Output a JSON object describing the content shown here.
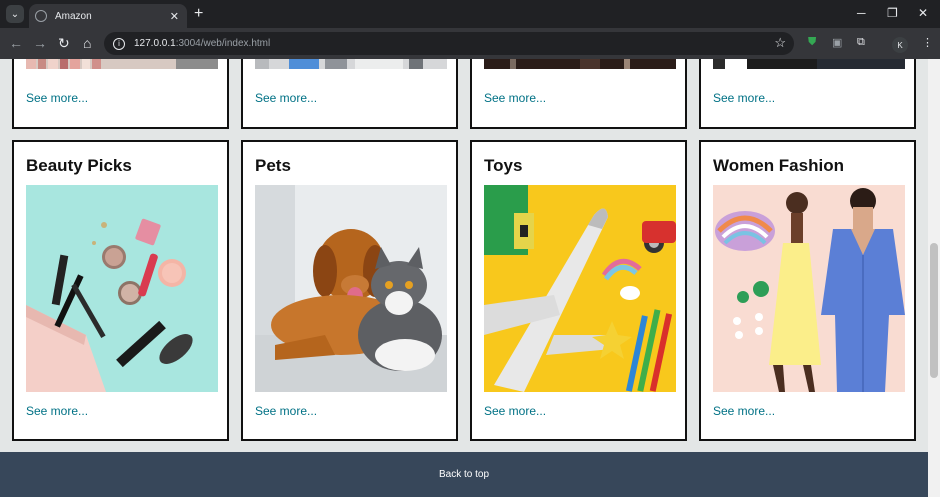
{
  "browser": {
    "tab_title": "Amazon",
    "url_host": "127.0.0.1",
    "url_path": ":3004/web/index.html",
    "profile_initial": "K"
  },
  "top_row": [
    {
      "link": "See more..."
    },
    {
      "link": "See more..."
    },
    {
      "link": "See more..."
    },
    {
      "link": "See more..."
    }
  ],
  "cards": [
    {
      "title": "Beauty Picks",
      "link": "See more..."
    },
    {
      "title": "Pets",
      "link": "See more..."
    },
    {
      "title": "Toys",
      "link": "See more..."
    },
    {
      "title": "Women Fashion",
      "link": "See more..."
    }
  ],
  "footer": {
    "back_to_top": "Back to top"
  },
  "colors": {
    "link": "#007185",
    "footer": "#37475a"
  }
}
